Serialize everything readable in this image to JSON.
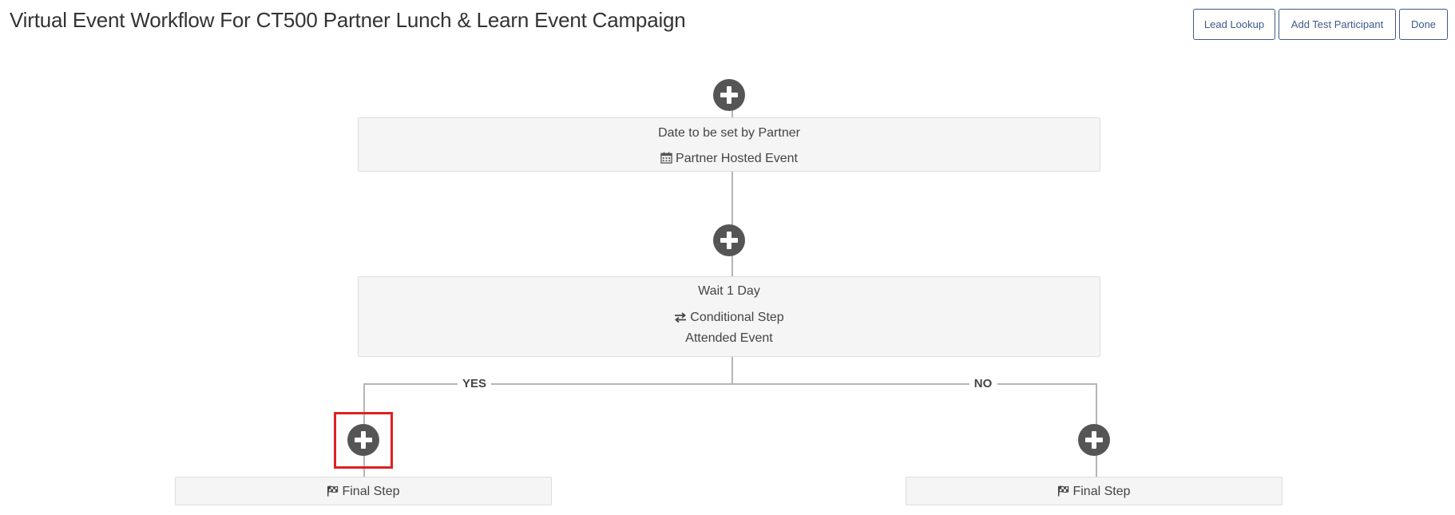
{
  "header": {
    "title": "Virtual Event Workflow For CT500 Partner Lunch & Learn Event Campaign",
    "buttons": {
      "lead_lookup": "Lead Lookup",
      "add_test_participant": "Add Test Participant",
      "done": "Done"
    }
  },
  "workflow": {
    "steps": [
      {
        "timing": "Date to be set by Partner",
        "type_icon": "calendar-icon",
        "type_label": "Partner Hosted Event"
      },
      {
        "timing": "Wait 1 Day",
        "type_icon": "exchange-arrows-icon",
        "type_label": "Conditional Step",
        "condition": "Attended Event"
      }
    ],
    "branches": {
      "yes": {
        "label": "YES",
        "final_step": {
          "icon": "checkered-flag-icon",
          "label": "Final Step"
        }
      },
      "no": {
        "label": "NO",
        "final_step": {
          "icon": "checkered-flag-icon",
          "label": "Final Step"
        }
      }
    }
  },
  "colors": {
    "accent_button": "#3e5a8a",
    "plus_button": "#555555",
    "highlight": "#e02020",
    "card_bg": "#f5f5f5",
    "connector": "#b5b5b5"
  }
}
